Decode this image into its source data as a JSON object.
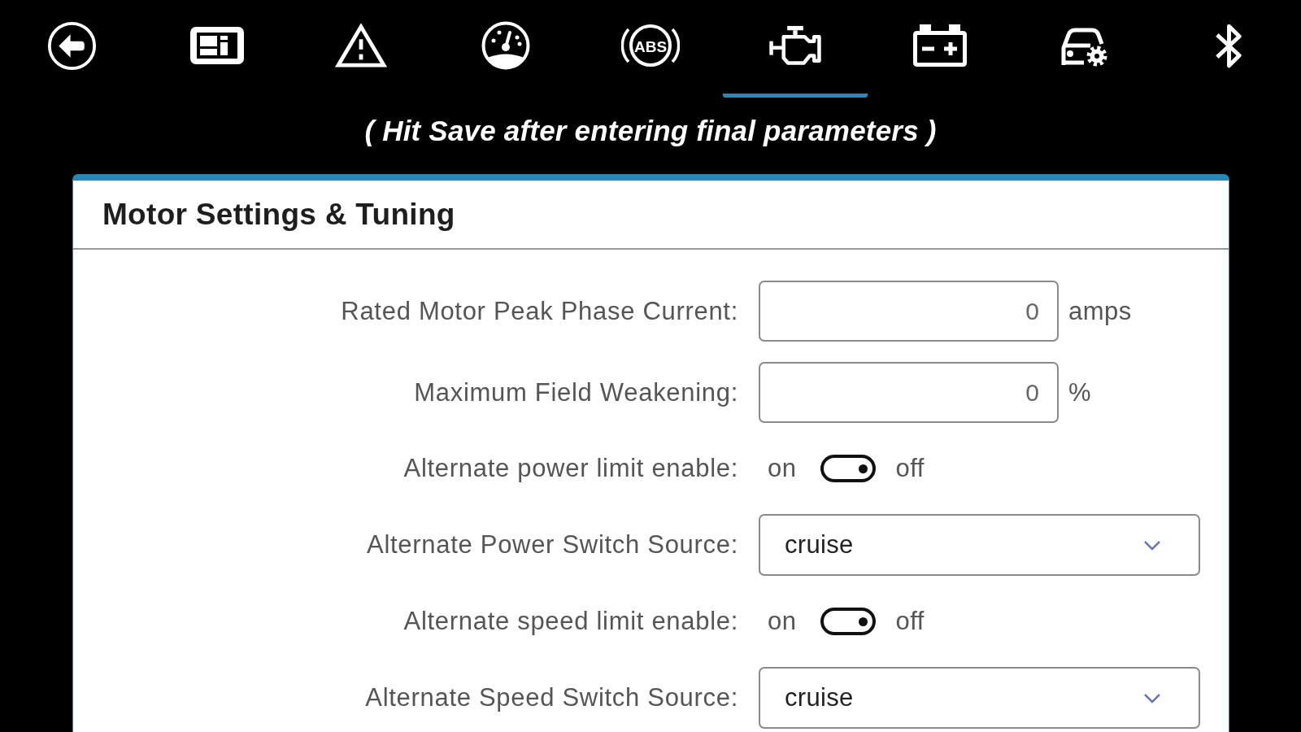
{
  "tabs": [
    {
      "kind": "back",
      "selected": false
    },
    {
      "kind": "dashboard",
      "selected": false
    },
    {
      "kind": "warning",
      "selected": false
    },
    {
      "kind": "gauge",
      "selected": false
    },
    {
      "kind": "abs",
      "label": "ABS",
      "selected": false
    },
    {
      "kind": "engine",
      "selected": true
    },
    {
      "kind": "battery",
      "selected": false
    },
    {
      "kind": "vehicle",
      "selected": false
    },
    {
      "kind": "bluetooth",
      "selected": false
    }
  ],
  "hint": "( Hit Save after entering final parameters )",
  "panel": {
    "title": "Motor Settings & Tuning",
    "fields": [
      {
        "kind": "number",
        "label": "Rated Motor Peak Phase Current:",
        "value": "0",
        "unit": "amps"
      },
      {
        "kind": "number",
        "label": "Maximum Field Weakening:",
        "value": "0",
        "unit": "%"
      },
      {
        "kind": "toggle",
        "label": "Alternate power limit enable:",
        "on_label": "on",
        "off_label": "off",
        "on": false
      },
      {
        "kind": "select",
        "label": "Alternate Power Switch Source:",
        "value": "cruise"
      },
      {
        "kind": "toggle",
        "label": "Alternate speed limit enable:",
        "on_label": "on",
        "off_label": "off",
        "on": false
      },
      {
        "kind": "select",
        "label": "Alternate Speed Switch Source:",
        "value": "cruise"
      }
    ]
  }
}
